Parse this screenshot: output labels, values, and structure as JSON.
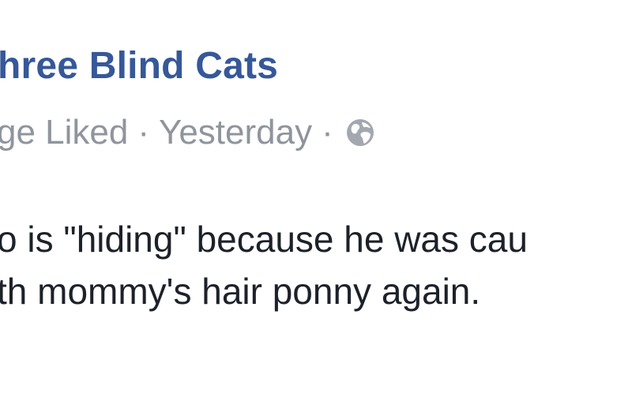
{
  "post": {
    "page_name": "hree Blind Cats",
    "meta": {
      "page_status": "ge Liked",
      "separator": "·",
      "timestamp": "Yesterday",
      "audience_icon": "globe-icon"
    },
    "text_lines": [
      "o is \"hiding\" because he was cau",
      "th mommy's hair ponny again."
    ]
  },
  "colors": {
    "link_blue": "#365899",
    "meta_gray": "#90949c",
    "body_text": "#1d2129"
  }
}
